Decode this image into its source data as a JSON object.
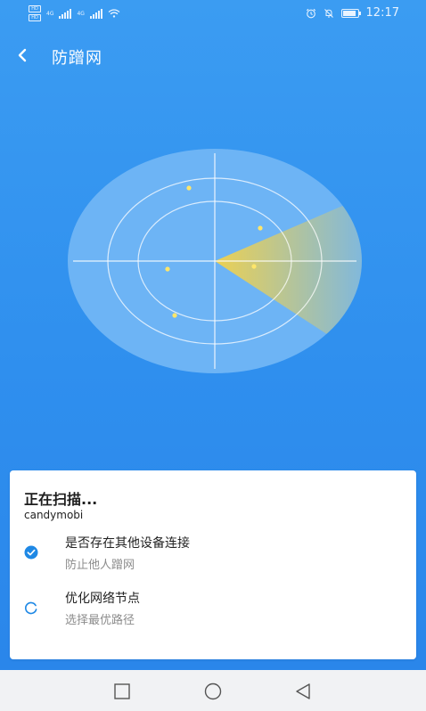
{
  "status_bar": {
    "sim_labels": [
      "HD",
      "HD"
    ],
    "network_labels": [
      "4G",
      "4G"
    ],
    "time": "12:17",
    "battery_level": 0.9
  },
  "header": {
    "title": "防蹭网",
    "back_icon": "chevron-left-icon"
  },
  "radar": {
    "colors": {
      "disc": "#6db4f5",
      "line": "#ffffff",
      "sweep": "#f3d24a",
      "dot": "#ffe66a"
    }
  },
  "scan_card": {
    "title": "正在扫描...",
    "network_name": "candymobi",
    "items": [
      {
        "title": "是否存在其他设备连接",
        "subtitle": "防止他人蹭网",
        "status": "done",
        "icon": "check-circle-icon"
      },
      {
        "title": "优化网络节点",
        "subtitle": "选择最优路径",
        "status": "loading",
        "icon": "loading-spinner-icon"
      }
    ],
    "accent": "#1e88e5"
  },
  "nav_bar": {
    "icons": [
      "square-recents-icon",
      "circle-home-icon",
      "triangle-back-icon"
    ]
  }
}
